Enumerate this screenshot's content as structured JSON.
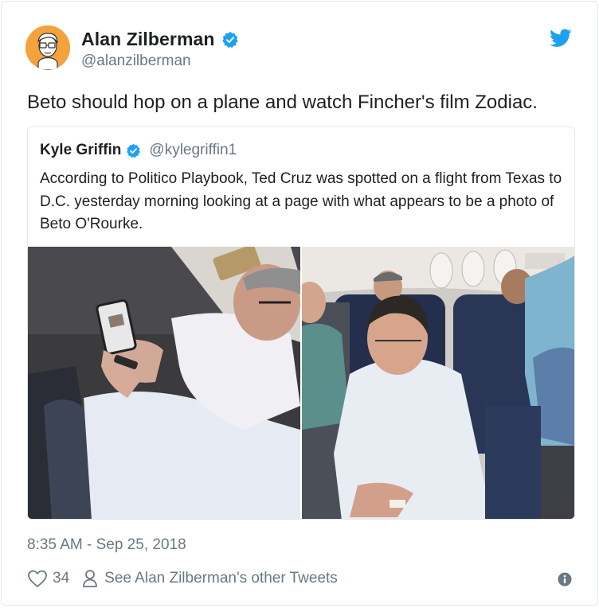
{
  "tweet": {
    "author_name": "Alan Zilberman",
    "author_handle": "@alanzilberman",
    "text": "Beto should hop on a plane and watch Fincher's film Zodiac.",
    "timestamp": "8:35 AM - Sep 25, 2018",
    "likes": "34",
    "profile_link": "See Alan Zilberman's other Tweets"
  },
  "quoted": {
    "author_name": "Kyle Griffin",
    "author_handle": "@kylegriffin1",
    "text": "According to Politico Playbook, Ted Cruz was spotted on a flight from Texas to D.C. yesterday morning looking at a page with what appears to be a photo of Beto O'Rourke."
  },
  "colors": {
    "twitter_blue": "#1da1f2",
    "secondary_text": "#697882",
    "avatar_bg": "#f4a23c"
  },
  "icons": {
    "verified": "verified-badge-icon",
    "bird": "twitter-bird-icon",
    "like": "heart-icon",
    "profile": "person-icon",
    "info": "info-icon"
  }
}
